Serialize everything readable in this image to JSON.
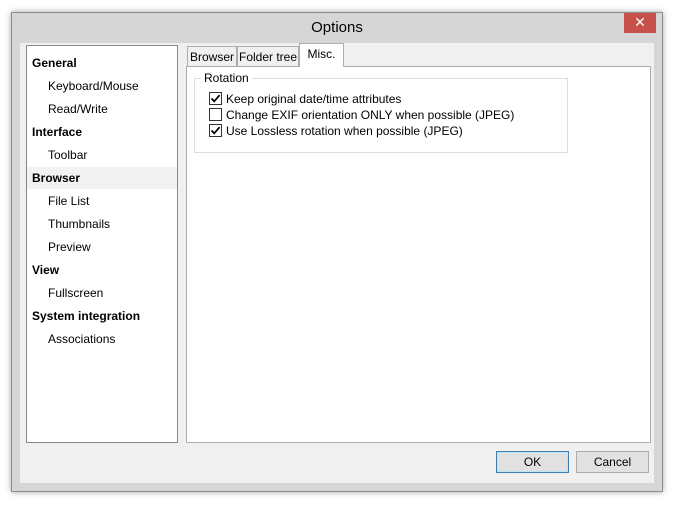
{
  "window": {
    "title": "Options",
    "close_glyph": "✕"
  },
  "nav": {
    "items": [
      {
        "label": "General",
        "kind": "category"
      },
      {
        "label": "Keyboard/Mouse",
        "kind": "sub"
      },
      {
        "label": "Read/Write",
        "kind": "sub"
      },
      {
        "label": "Interface",
        "kind": "category"
      },
      {
        "label": "Toolbar",
        "kind": "sub"
      },
      {
        "label": "Browser",
        "kind": "category",
        "selected": true
      },
      {
        "label": "File List",
        "kind": "sub"
      },
      {
        "label": "Thumbnails",
        "kind": "sub"
      },
      {
        "label": "Preview",
        "kind": "sub"
      },
      {
        "label": "View",
        "kind": "category"
      },
      {
        "label": "Fullscreen",
        "kind": "sub"
      },
      {
        "label": "System integration",
        "kind": "category"
      },
      {
        "label": "Associations",
        "kind": "sub"
      }
    ]
  },
  "tabs": [
    {
      "label": "Browser",
      "active": false
    },
    {
      "label": "Folder tree",
      "active": false
    },
    {
      "label": "Misc.",
      "active": true
    }
  ],
  "rotation_group": {
    "label": "Rotation",
    "options": [
      {
        "label": "Keep original date/time attributes",
        "checked": true
      },
      {
        "label": "Change EXIF orientation ONLY when possible (JPEG)",
        "checked": false
      },
      {
        "label": "Use Lossless rotation when possible (JPEG)",
        "checked": true
      }
    ]
  },
  "buttons": {
    "ok_label": "OK",
    "cancel_label": "Cancel"
  },
  "colors": {
    "close_button": "#c7504b",
    "frame": "#d6d6d6",
    "selected_item": "#f2f2f2"
  }
}
